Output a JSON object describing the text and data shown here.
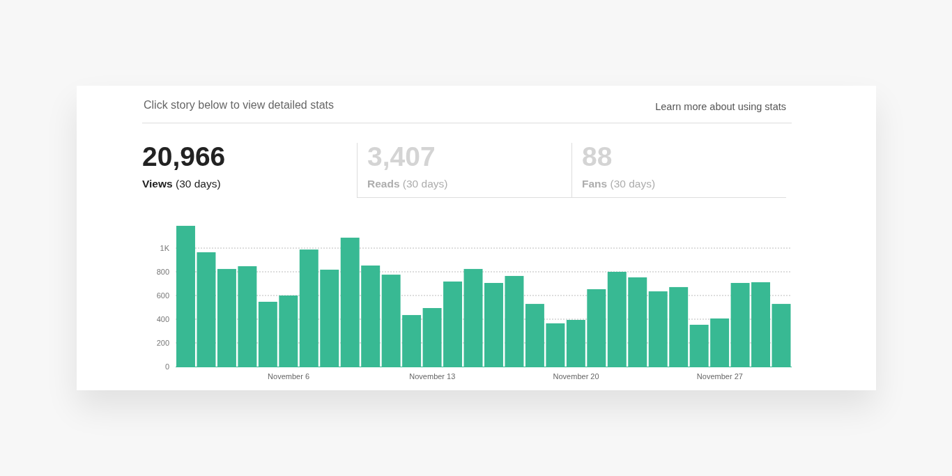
{
  "header": {
    "instruction": "Click story below to view detailed stats",
    "help_link": "Learn more about using stats"
  },
  "stats": [
    {
      "value": "20,966",
      "label": "Views",
      "period": "(30 days)",
      "selected": true
    },
    {
      "value": "3,407",
      "label": "Reads",
      "period": "(30 days)",
      "selected": false
    },
    {
      "value": "88",
      "label": "Fans",
      "period": "(30 days)",
      "selected": false
    }
  ],
  "chart_data": {
    "type": "bar",
    "categories": [
      null,
      null,
      null,
      null,
      null,
      "November 6",
      null,
      null,
      null,
      null,
      null,
      null,
      "November 13",
      null,
      null,
      null,
      null,
      null,
      null,
      "November 20",
      null,
      null,
      null,
      null,
      null,
      null,
      "November 27",
      null,
      null,
      null
    ],
    "grid": true,
    "series": [
      {
        "color": "#38b993",
        "values": [
          1188,
          965,
          824,
          847,
          547,
          600,
          988,
          818,
          1088,
          853,
          776,
          435,
          494,
          718,
          824,
          706,
          765,
          529,
          365,
          394,
          653,
          800,
          753,
          635,
          671,
          353,
          406,
          706,
          712,
          529
        ]
      }
    ],
    "ylim": [
      0,
      1200
    ],
    "yticks": [
      {
        "value": 0,
        "label": "0"
      },
      {
        "value": 200,
        "label": "200"
      },
      {
        "value": 400,
        "label": "400"
      },
      {
        "value": 600,
        "label": "600"
      },
      {
        "value": 800,
        "label": "800"
      },
      {
        "value": 1000,
        "label": "1K"
      }
    ]
  }
}
